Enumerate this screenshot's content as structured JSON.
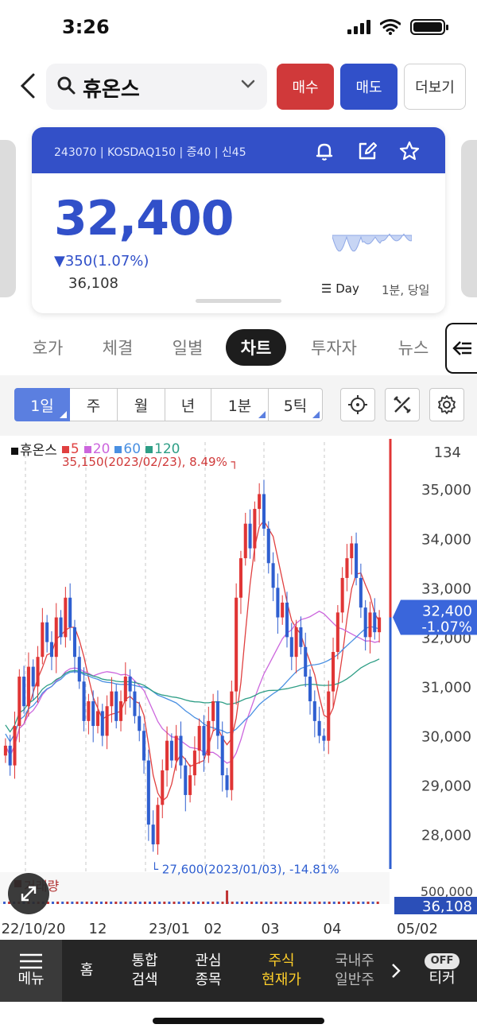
{
  "status": {
    "time": "3:26"
  },
  "header": {
    "back_icon": "chevron-left-icon",
    "search_name": "휴온스",
    "buy_label": "매수",
    "sell_label": "매도",
    "more_label": "더보기"
  },
  "quote": {
    "code_line": "243070 | KOSDAQ150 | 증40 | 신45",
    "price": "32,400",
    "change": "▼350(1.07%)",
    "volume": "36,108",
    "period_day": "☰ Day",
    "period_sub": "1분, 당일"
  },
  "tabs": [
    "호가",
    "체결",
    "일별",
    "차트",
    "투자자",
    "뉴스"
  ],
  "tabs_active": "차트",
  "toolbar": {
    "periods": [
      "1일",
      "주",
      "월",
      "년",
      "1분",
      "5틱"
    ],
    "active_period": "1일"
  },
  "chart_data": {
    "type": "candlestick",
    "legend": [
      {
        "name": "휴온스",
        "color": "#111111"
      },
      {
        "name": "5",
        "color": "#e04040"
      },
      {
        "name": "20",
        "color": "#cc66dd"
      },
      {
        "name": "60",
        "color": "#4a90e2"
      },
      {
        "name": "120",
        "color": "#2e9e86"
      }
    ],
    "y_ticks": [
      "35,000",
      "34,000",
      "33,000",
      "32,000",
      "31,000",
      "30,000",
      "29,000",
      "28,000"
    ],
    "y_tick_values": [
      35000,
      34000,
      33000,
      32000,
      31000,
      30000,
      29000,
      28000
    ],
    "ylim": [
      27300,
      35600
    ],
    "top_right_label": "134",
    "x_labels": [
      "22/10/20",
      "12",
      "23/01",
      "02",
      "03",
      "04",
      "05/02"
    ],
    "max_annotation": "35,150(2023/02/23), 8.49%",
    "min_annotation": "27,600(2023/01/03), -14.81%",
    "current_price_label": "32,400",
    "current_change_label": "-1.07%",
    "volume_title": "거래량",
    "volume_axis_label": "500,000",
    "volume_current_label": "36,108",
    "ohlc_close": [
      29800,
      29400,
      30200,
      31200,
      30600,
      31400,
      31000,
      31600,
      32300,
      31900,
      31600,
      32400,
      32000,
      32800,
      32200,
      31600,
      31100,
      30300,
      30700,
      30200,
      30500,
      30000,
      30600,
      30900,
      30300,
      30700,
      31200,
      30900,
      30400,
      30100,
      29500,
      28200,
      27800,
      28600,
      29300,
      29900,
      29500,
      30000,
      29400,
      28800,
      29200,
      29700,
      30200,
      29600,
      30300,
      30700,
      30000,
      29200,
      28900,
      30900,
      32800,
      33600,
      34300,
      33800,
      34600,
      34900,
      34200,
      33500,
      33000,
      32400,
      32700,
      32000,
      31600,
      32200,
      31800,
      31200,
      30700,
      30300,
      30000,
      29900,
      30900,
      31700,
      32500,
      33200,
      33600,
      33900,
      33200,
      32600,
      32000,
      32500,
      32100,
      32400
    ],
    "volume_spike_index": 48
  },
  "bottom_nav": {
    "menu_label": "메뉴",
    "items": [
      "홈",
      "통합\n검색",
      "관심\n종목",
      "주식\n현재가",
      "국내주\n일반주"
    ],
    "active": "주식\n현재가",
    "ticker_toggle": "OFF",
    "ticker_label": "티커"
  }
}
